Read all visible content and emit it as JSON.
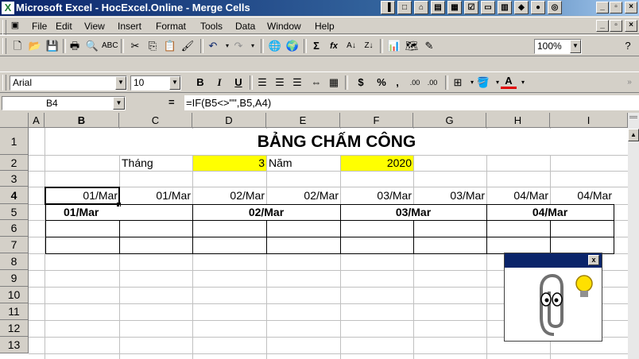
{
  "window": {
    "app_icon": "X",
    "title": "Microsoft Excel - HocExcel.Online - Merge Cells"
  },
  "menu": {
    "items": [
      {
        "label": "File"
      },
      {
        "label": "Edit"
      },
      {
        "label": "View"
      },
      {
        "label": "Insert"
      },
      {
        "label": "Format"
      },
      {
        "label": "Tools"
      },
      {
        "label": "Data"
      },
      {
        "label": "Window"
      },
      {
        "label": "Help"
      }
    ]
  },
  "toolbar_standard": {
    "zoom": "100%",
    "sigma": "Σ",
    "fx": "fx"
  },
  "toolbar_format": {
    "font": "Arial",
    "size": "10",
    "bold": "B",
    "italic": "I",
    "underline": "U",
    "currency": "$",
    "percent": "%",
    "comma": ",",
    "inc_decimal": ".00",
    "dec_decimal": ".00",
    "font_color_letter": "A"
  },
  "formula_bar": {
    "name_box": "B4",
    "equals": "=",
    "formula": "=IF(B5<>\"\",B5,A4)"
  },
  "sheet": {
    "columns": [
      "A",
      "B",
      "C",
      "D",
      "E",
      "F",
      "G",
      "H",
      "I"
    ],
    "rows": [
      "1",
      "2",
      "3",
      "4",
      "5",
      "6",
      "7",
      "8",
      "9",
      "10",
      "11",
      "12",
      "13"
    ],
    "title": "BẢNG CHẤM CÔNG",
    "month_label": "Tháng",
    "month_value": "3",
    "year_label": "Năm",
    "year_value": "2020",
    "row4": [
      "01/Mar",
      "01/Mar",
      "02/Mar",
      "02/Mar",
      "03/Mar",
      "03/Mar",
      "04/Mar",
      "04/Mar"
    ],
    "row5": [
      "01/Mar",
      "02/Mar",
      "03/Mar",
      "04/Mar"
    ],
    "colors": {
      "highlight": "#ffff00"
    }
  },
  "assistant": {
    "close_label": "x",
    "icons": [
      "paperclip-icon",
      "lightbulb-icon"
    ]
  }
}
